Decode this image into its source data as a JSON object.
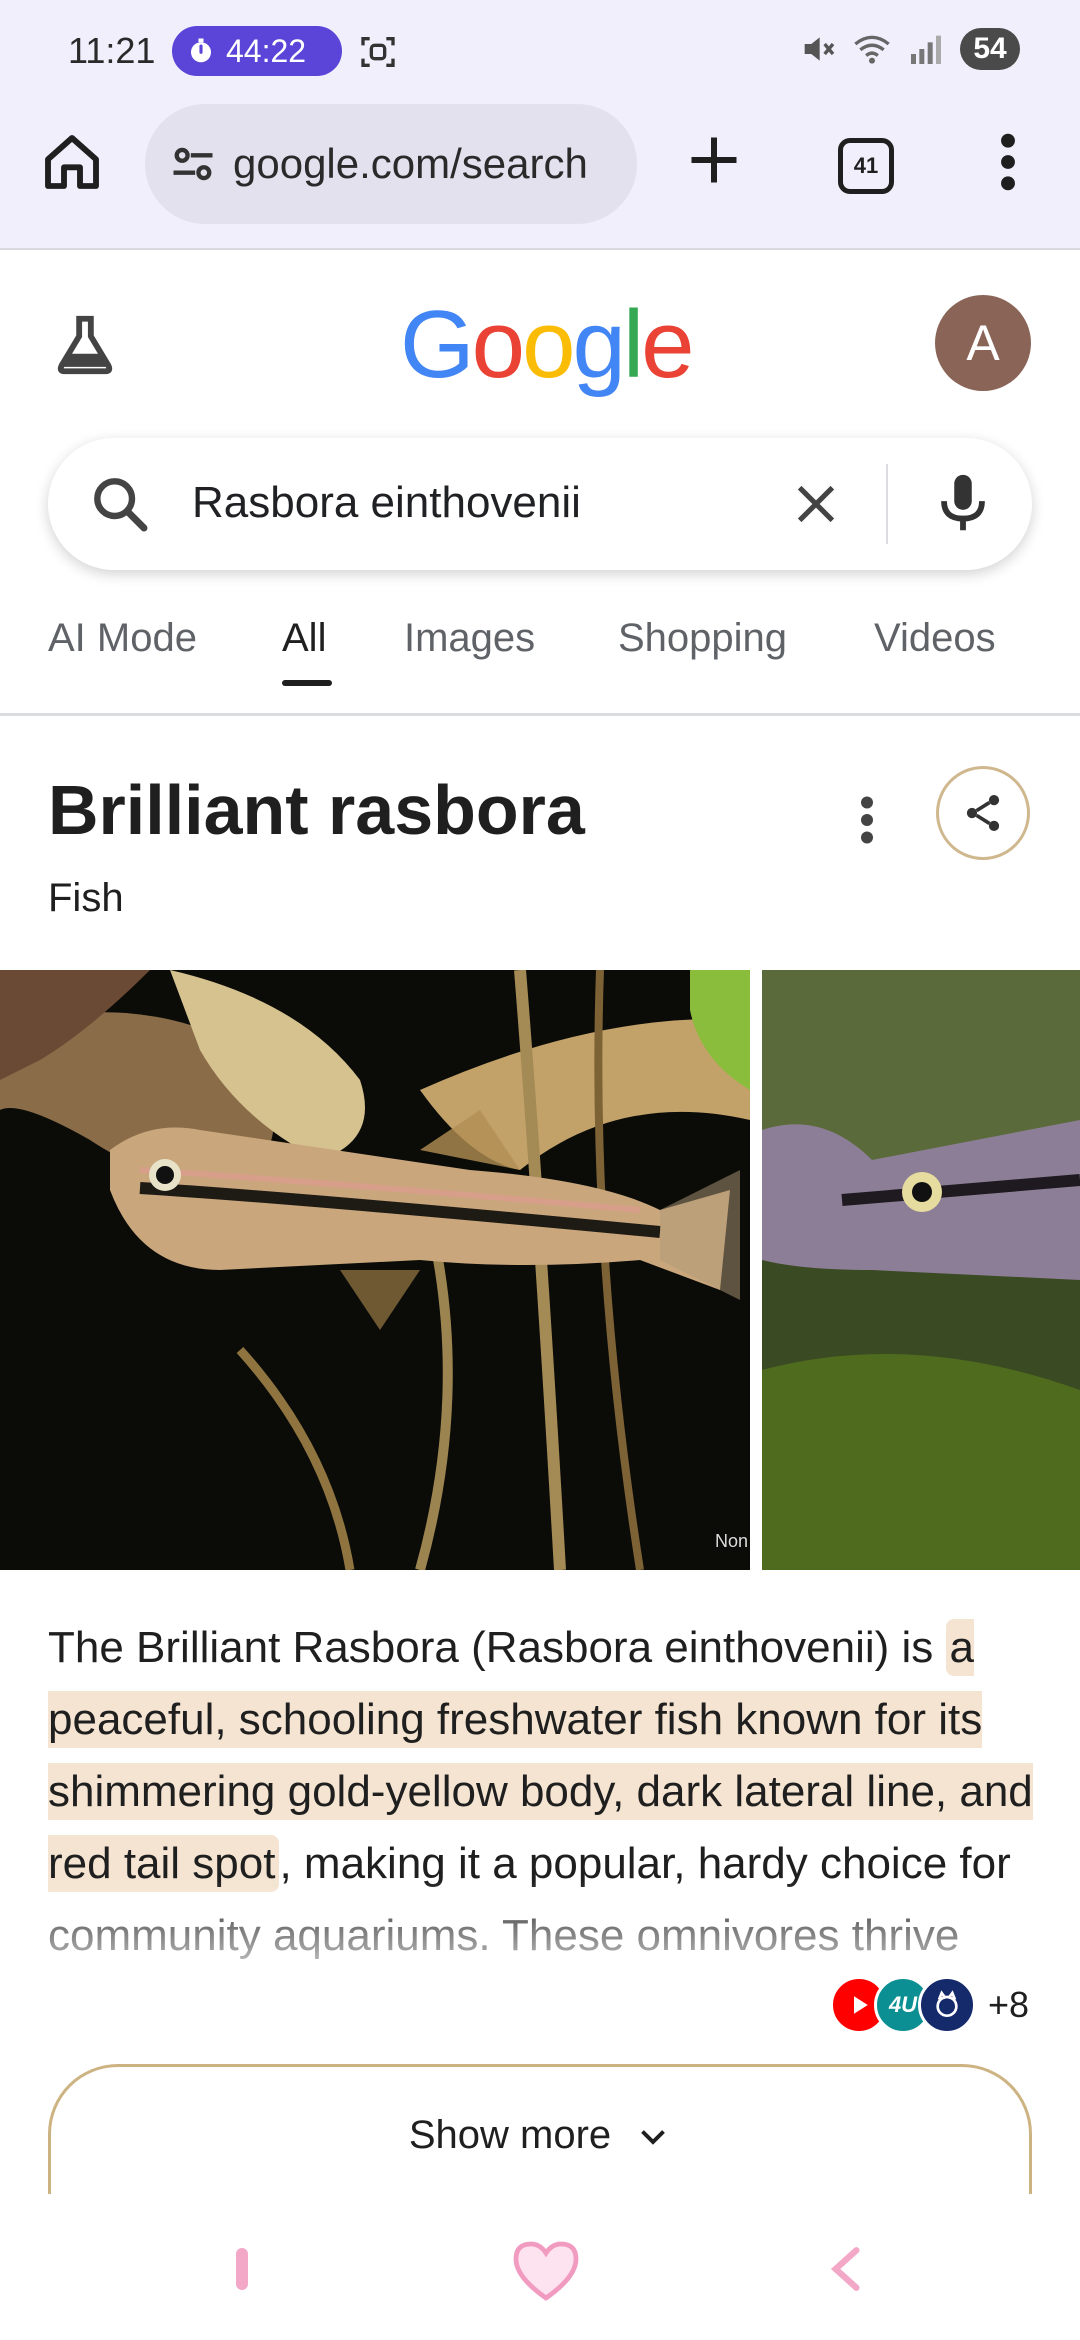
{
  "status": {
    "time": "11:21",
    "timer": "44:22",
    "battery": "54"
  },
  "browser": {
    "url": "google.com/search",
    "tab_count": "41"
  },
  "google": {
    "logo_letters": [
      "G",
      "o",
      "o",
      "g",
      "l",
      "e"
    ],
    "logo_colors": [
      "#4285F4",
      "#EA4335",
      "#FBBC05",
      "#4285F4",
      "#34A853",
      "#EA4335"
    ],
    "avatar_letter": "A",
    "search_query": "Rasbora einthovenii"
  },
  "tabs": [
    {
      "label": "AI Mode"
    },
    {
      "label": "All"
    },
    {
      "label": "Images"
    },
    {
      "label": "Shopping"
    },
    {
      "label": "Videos"
    }
  ],
  "knowledge_panel": {
    "title": "Brilliant rasbora",
    "subtitle": "Fish",
    "image_credit": "Non",
    "description": {
      "intro": "The Brilliant Rasbora (Rasbora einthovenii) is ",
      "highlight": "a peaceful, schooling freshwater fish known for its shimmering gold-yellow body, dark lateral line, and red tail spot",
      "rest": ", making it a popular, hardy choice for community aquariums. These omnivores thrive"
    },
    "sources": {
      "icons": [
        "youtube-icon",
        "fish4u-icon",
        "education-icon"
      ],
      "badge_text": "4U",
      "more_count": "+8"
    },
    "show_more_label": "Show more"
  },
  "colors": {
    "chrome_bg": "#f1effb",
    "timer_pill": "#5b45d8",
    "avatar_bg": "#8a6457",
    "highlight": "#f4e4d1",
    "accent_border": "#cdb382",
    "nav_accent": "#f4a8c8"
  }
}
